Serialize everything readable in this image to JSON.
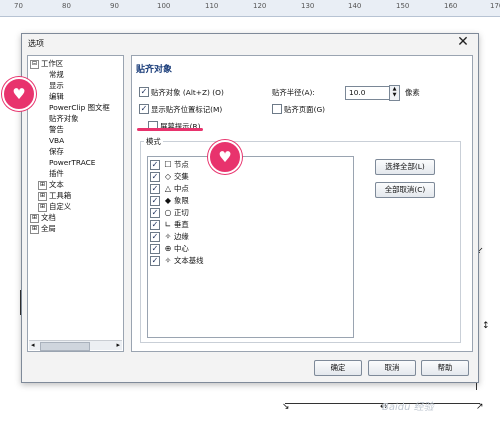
{
  "ruler": {
    "labels": [
      "70",
      "80",
      "90",
      "100",
      "110",
      "120",
      "130",
      "140",
      "150",
      "160",
      "170"
    ]
  },
  "dialog": {
    "title": "选项",
    "tree": [
      {
        "label": "工作区",
        "expander": "⊟",
        "level": 0
      },
      {
        "label": "常规",
        "expander": "",
        "level": 1
      },
      {
        "label": "显示",
        "expander": "",
        "level": 1
      },
      {
        "label": "编辑",
        "expander": "",
        "level": 1
      },
      {
        "label": "PowerClip 图文框",
        "expander": "",
        "level": 1
      },
      {
        "label": "贴齐对象",
        "expander": "",
        "level": 1
      },
      {
        "label": "警告",
        "expander": "",
        "level": 1
      },
      {
        "label": "VBA",
        "expander": "",
        "level": 1
      },
      {
        "label": "保存",
        "expander": "",
        "level": 1
      },
      {
        "label": "PowerTRACE",
        "expander": "",
        "level": 1
      },
      {
        "label": "插件",
        "expander": "",
        "level": 1
      },
      {
        "label": "文本",
        "expander": "⊞",
        "level": 1
      },
      {
        "label": "工具箱",
        "expander": "⊞",
        "level": 1
      },
      {
        "label": "自定义",
        "expander": "⊞",
        "level": 1
      },
      {
        "label": "文档",
        "expander": "⊞",
        "level": 0
      },
      {
        "label": "全局",
        "expander": "⊞",
        "level": 0
      }
    ],
    "panel": {
      "heading": "贴齐对象",
      "snap_objects": {
        "label": "贴齐对象 (Alt+Z) (O)",
        "checked": true
      },
      "show_marker": {
        "label": "显示贴齐位置标记(M)",
        "checked": true
      },
      "screen_tips": {
        "label": "屏幕提示(R)",
        "checked": false
      },
      "snap_radius": {
        "label": "贴齐半径(A):",
        "value": "10.0",
        "unit": "像素"
      },
      "snap_page": {
        "label": "贴齐页面(G)",
        "checked": false
      },
      "mode_legend": "模式",
      "modes": [
        {
          "icon": "☐",
          "label": "节点",
          "checked": true
        },
        {
          "icon": "◇",
          "label": "交集",
          "checked": true
        },
        {
          "icon": "△",
          "label": "中点",
          "checked": true
        },
        {
          "icon": "◆",
          "label": "象限",
          "checked": true
        },
        {
          "icon": "○",
          "label": "正切",
          "checked": true
        },
        {
          "icon": "∟",
          "label": "垂直",
          "checked": true
        },
        {
          "icon": "✧",
          "label": "边缘",
          "checked": true
        },
        {
          "icon": "⊕",
          "label": "中心",
          "checked": true
        },
        {
          "icon": "✧",
          "label": "文本基线",
          "checked": true
        }
      ],
      "select_all": "选择全部(L)",
      "deselect_all": "全部取消(C)"
    },
    "buttons": {
      "ok": "确定",
      "cancel": "取消",
      "help": "帮助"
    }
  },
  "watermark": "Baidu 经验",
  "accent_color": "#e8336d"
}
